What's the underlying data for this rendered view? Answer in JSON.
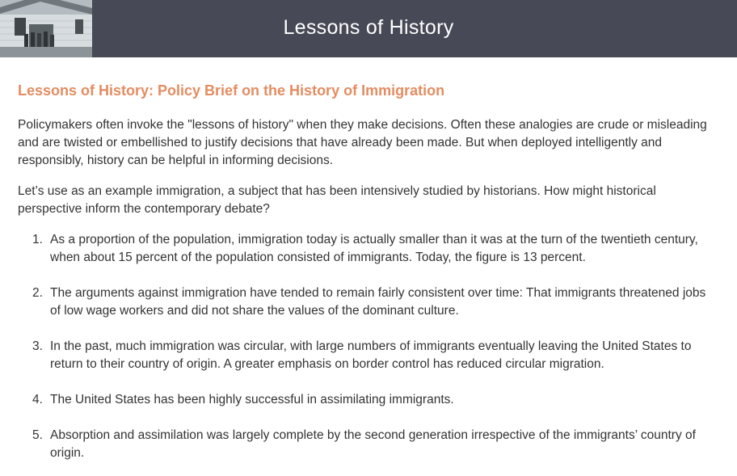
{
  "header": {
    "title": "Lessons of History"
  },
  "main": {
    "brief_title": "Lessons of History: Policy Brief on the History of Immigration",
    "paragraphs": [
      "Policymakers often invoke the \"lessons of history\" when they make decisions.  Often these analogies are crude or misleading and are twisted or embellished to justify decisions that have already been made. But when deployed intelligently and responsibly, history can be helpful in informing decisions.",
      "Let’s use as an example immigration, a subject that has been intensively studied by historians. How might historical perspective inform the contemporary debate?"
    ],
    "points": [
      {
        "num": "1.",
        "text": "As a proportion of the population, immigration today is actually smaller than it was at the turn of the twentieth century, when about 15 percent of the population consisted of immigrants. Today, the figure is 13 percent."
      },
      {
        "num": "2.",
        "text": "The arguments against immigration have tended to remain fairly consistent over time: That immigrants threatened jobs of low wage workers and did not share the values of the dominant culture."
      },
      {
        "num": "3.",
        "text": "In the past, much immigration was circular, with large numbers of immigrants eventually leaving the United States to return to their country of origin.  A greater emphasis on border control has reduced circular migration."
      },
      {
        "num": "4.",
        "text": "The United States has been highly successful in assimilating immigrants."
      },
      {
        "num": "5.",
        "text": "Absorption and assimilation was largely complete by the second generation irrespective of the immigrants’ country of origin."
      }
    ]
  },
  "colors": {
    "header_bg": "#474a56",
    "title_accent": "#e48c61",
    "body_text": "#333333"
  }
}
